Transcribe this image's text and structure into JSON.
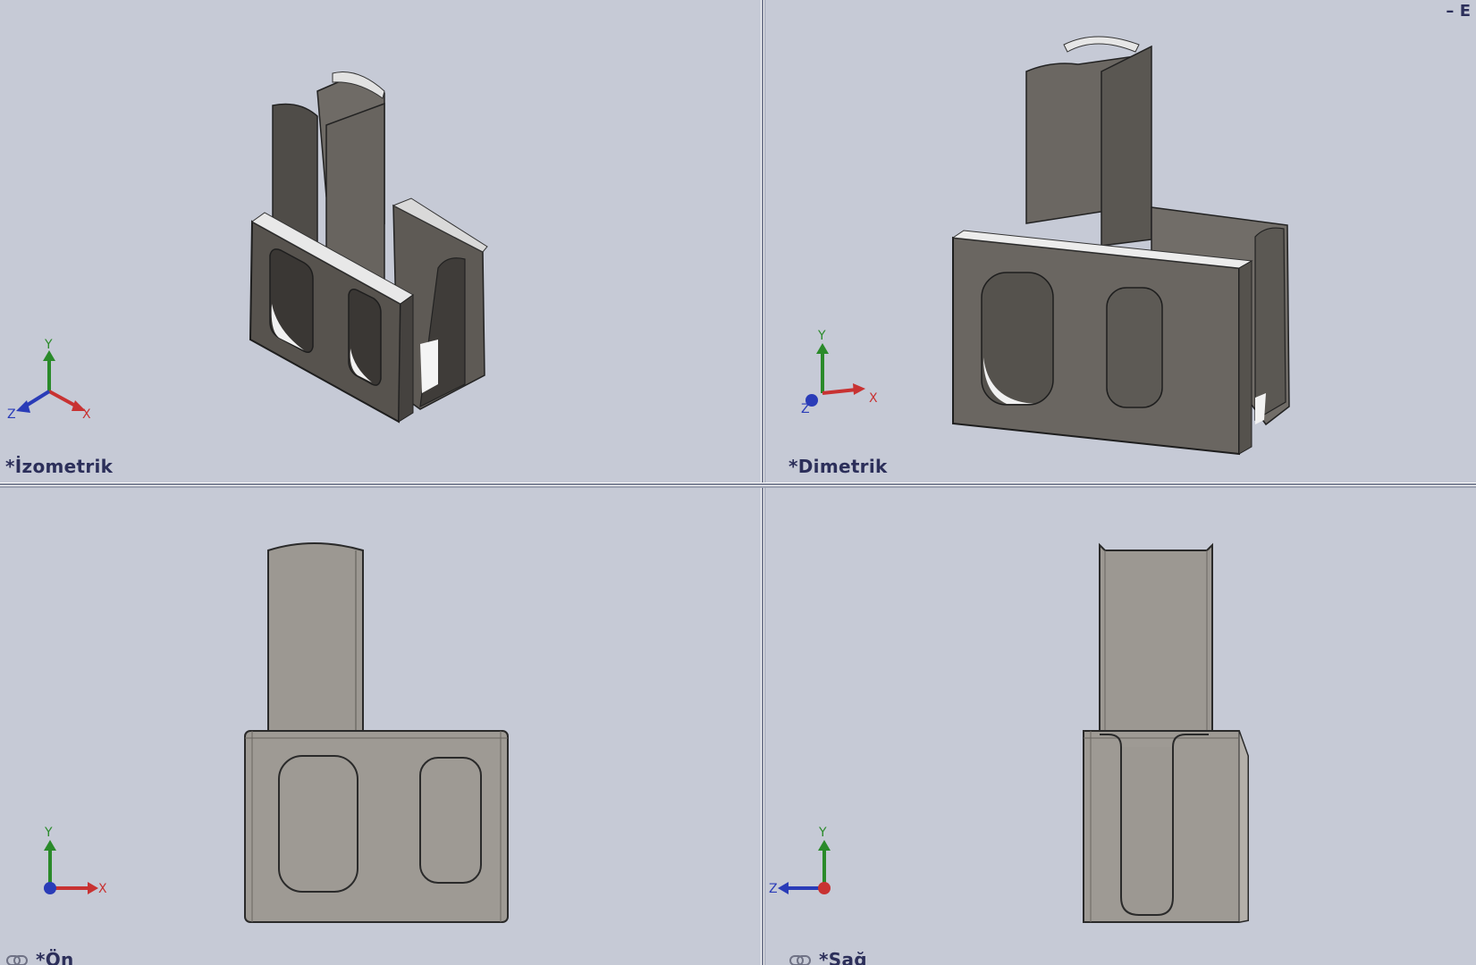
{
  "viewports": {
    "iso": {
      "label": "*İzometrik"
    },
    "dimetric": {
      "label": "*Dimetrik"
    },
    "front": {
      "label": "*Ön"
    },
    "right": {
      "label": "*Sağ"
    }
  },
  "triad": {
    "x": "X",
    "y": "Y",
    "z": "Z"
  },
  "window_controls": {
    "minimize": "–",
    "restore": "E"
  },
  "colors": {
    "background": "#c6cad6",
    "part_dark": "#5d5a55",
    "part_light": "#9d9993",
    "label": "#2c2f5a"
  }
}
